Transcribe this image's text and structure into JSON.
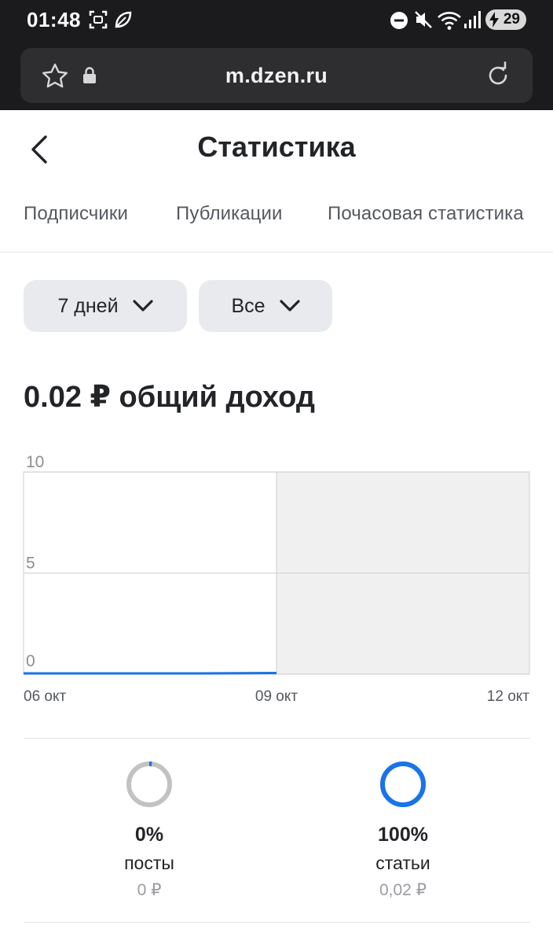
{
  "status_bar": {
    "time": "01:48",
    "battery": "29",
    "icons": [
      "screenshot-icon",
      "leaf-icon",
      "dnd-icon",
      "mute-icon",
      "wifi-icon",
      "signal-icon",
      "charging-icon"
    ]
  },
  "browser": {
    "url": "m.dzen.ru",
    "icons": [
      "star-icon",
      "lock-icon",
      "reload-icon"
    ]
  },
  "header": {
    "title": "Статистика"
  },
  "tabs": [
    {
      "label": "Подписчики"
    },
    {
      "label": "Публикации"
    },
    {
      "label": "Почасовая статистика"
    }
  ],
  "filters": {
    "period": "7 дней",
    "type": "Все"
  },
  "headline": "0.02 ₽ общий доход",
  "chart_data": {
    "type": "line",
    "x_labels": [
      "06 окт",
      "09 окт",
      "12 окт"
    ],
    "y_ticks": [
      10,
      5,
      0
    ],
    "ylim": [
      0,
      10
    ],
    "series": [
      {
        "values": [
          0,
          0,
          0,
          0.02
        ]
      }
    ],
    "future_region_from": "09 окт",
    "colors": {
      "line": "#1a73e8",
      "future": "#f0f0f0",
      "grid": "#d6d6d6"
    }
  },
  "breakdown": [
    {
      "percent": "0%",
      "label": "посты",
      "amount": "0 ₽",
      "fraction": 0.0,
      "color": "#c2c2c2"
    },
    {
      "percent": "100%",
      "label": "статьи",
      "amount": "0,02 ₽",
      "fraction": 1.0,
      "color": "#1a73e8"
    }
  ]
}
